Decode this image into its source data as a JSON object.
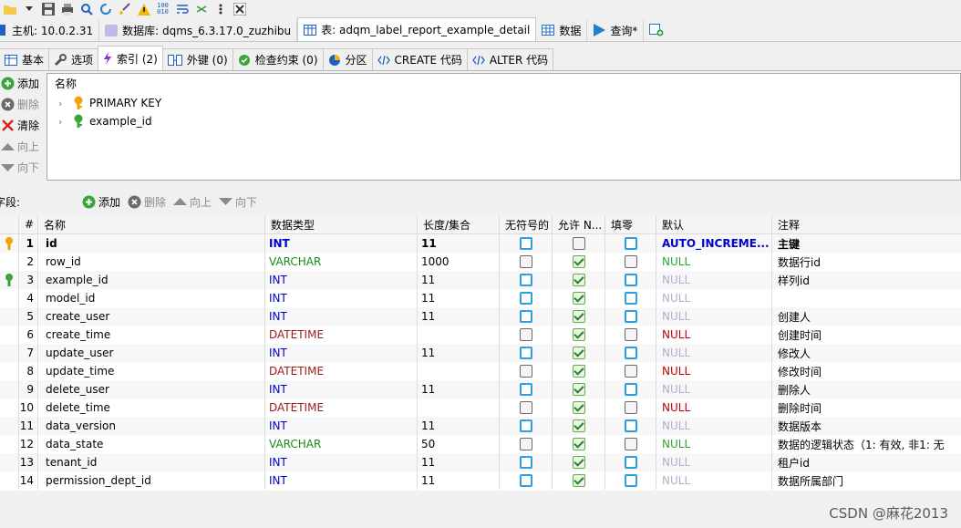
{
  "conn_row": {
    "host": "主机: 10.0.2.31",
    "database": "数据库: dqms_6.3.17.0_zuzhibu",
    "table": "表: adqm_label_report_example_detail",
    "data_tab": "数据",
    "query_tab": "查询*"
  },
  "sub_tabs": [
    {
      "label": "基本"
    },
    {
      "label": "选项"
    },
    {
      "label": "索引 (2)"
    },
    {
      "label": "外键 (0)"
    },
    {
      "label": "检查约束 (0)"
    },
    {
      "label": "分区"
    },
    {
      "label": "CREATE 代码"
    },
    {
      "label": "ALTER 代码"
    }
  ],
  "index_side": {
    "add": "添加",
    "delete": "删除",
    "clear": "清除",
    "up": "向上",
    "down": "向下"
  },
  "index_list": {
    "header": "名称",
    "items": [
      {
        "label": "PRIMARY KEY",
        "key_color": "#f0a20a"
      },
      {
        "label": "example_id",
        "key_color": "#3aa43a"
      }
    ]
  },
  "fields_bar": {
    "label": "字段:",
    "add": "添加",
    "delete": "删除",
    "up": "向上",
    "down": "向下"
  },
  "grid": {
    "headers": {
      "num": "#",
      "name": "名称",
      "type": "数据类型",
      "len": "长度/集合",
      "unsigned": "无符号的",
      "nullable": "允许 N...",
      "zerofill": "填零",
      "default": "默认",
      "comment": "注释"
    },
    "rows": [
      {
        "key": "primary",
        "num": "1",
        "name": "id",
        "type": "INT",
        "len": "11",
        "unsigned": "blue",
        "nullable": "gray",
        "zerofill": "blue",
        "default": "AUTO_INCREME...",
        "def_style": "autoinc",
        "comment": "主键",
        "bold": true
      },
      {
        "key": "",
        "num": "2",
        "name": "row_id",
        "type": "VARCHAR",
        "len": "1000",
        "unsigned": "gray",
        "nullable": "green",
        "zerofill": "gray",
        "default": "NULL",
        "def_style": "null-green",
        "comment": "数据行id",
        "bold": false
      },
      {
        "key": "index",
        "num": "3",
        "name": "example_id",
        "type": "INT",
        "len": "11",
        "unsigned": "blue",
        "nullable": "green",
        "zerofill": "blue",
        "default": "NULL",
        "def_style": "null-gray",
        "comment": "样列id",
        "bold": false
      },
      {
        "key": "",
        "num": "4",
        "name": "model_id",
        "type": "INT",
        "len": "11",
        "unsigned": "blue",
        "nullable": "green",
        "zerofill": "blue",
        "default": "NULL",
        "def_style": "null-gray",
        "comment": "",
        "bold": false
      },
      {
        "key": "",
        "num": "5",
        "name": "create_user",
        "type": "INT",
        "len": "11",
        "unsigned": "blue",
        "nullable": "green",
        "zerofill": "blue",
        "default": "NULL",
        "def_style": "null-gray",
        "comment": "创建人",
        "bold": false
      },
      {
        "key": "",
        "num": "6",
        "name": "create_time",
        "type": "DATETIME",
        "len": "",
        "unsigned": "gray",
        "nullable": "green",
        "zerofill": "gray",
        "default": "NULL",
        "def_style": "null-red",
        "comment": "创建时间",
        "bold": false
      },
      {
        "key": "",
        "num": "7",
        "name": "update_user",
        "type": "INT",
        "len": "11",
        "unsigned": "blue",
        "nullable": "green",
        "zerofill": "blue",
        "default": "NULL",
        "def_style": "null-gray",
        "comment": "修改人",
        "bold": false
      },
      {
        "key": "",
        "num": "8",
        "name": "update_time",
        "type": "DATETIME",
        "len": "",
        "unsigned": "gray",
        "nullable": "green",
        "zerofill": "gray",
        "default": "NULL",
        "def_style": "null-red",
        "comment": "修改时间",
        "bold": false
      },
      {
        "key": "",
        "num": "9",
        "name": "delete_user",
        "type": "INT",
        "len": "11",
        "unsigned": "blue",
        "nullable": "green",
        "zerofill": "blue",
        "default": "NULL",
        "def_style": "null-gray",
        "comment": "删除人",
        "bold": false
      },
      {
        "key": "",
        "num": "10",
        "name": "delete_time",
        "type": "DATETIME",
        "len": "",
        "unsigned": "gray",
        "nullable": "green",
        "zerofill": "gray",
        "default": "NULL",
        "def_style": "null-red",
        "comment": "删除时间",
        "bold": false
      },
      {
        "key": "",
        "num": "11",
        "name": "data_version",
        "type": "INT",
        "len": "11",
        "unsigned": "blue",
        "nullable": "green",
        "zerofill": "blue",
        "default": "NULL",
        "def_style": "null-gray",
        "comment": "数据版本",
        "bold": false
      },
      {
        "key": "",
        "num": "12",
        "name": "data_state",
        "type": "VARCHAR",
        "len": "50",
        "unsigned": "gray",
        "nullable": "green",
        "zerofill": "gray",
        "default": "NULL",
        "def_style": "null-green",
        "comment": "数据的逻辑状态（1: 有效, 非1: 无",
        "bold": false
      },
      {
        "key": "",
        "num": "13",
        "name": "tenant_id",
        "type": "INT",
        "len": "11",
        "unsigned": "blue",
        "nullable": "green",
        "zerofill": "blue",
        "default": "NULL",
        "def_style": "null-gray",
        "comment": "租户id",
        "bold": false
      },
      {
        "key": "",
        "num": "14",
        "name": "permission_dept_id",
        "type": "INT",
        "len": "11",
        "unsigned": "blue",
        "nullable": "green",
        "zerofill": "blue",
        "default": "NULL",
        "def_style": "null-gray",
        "comment": "数据所属部门",
        "bold": false
      }
    ]
  },
  "watermark": "CSDN @麻花2013"
}
